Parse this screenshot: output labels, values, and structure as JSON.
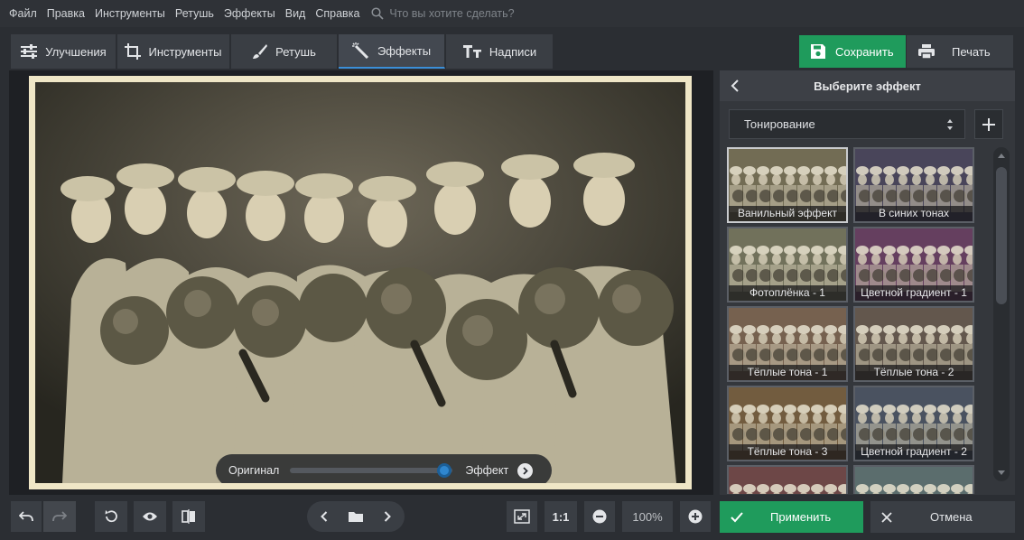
{
  "menu": {
    "items": [
      "Файл",
      "Правка",
      "Инструменты",
      "Ретушь",
      "Эффекты",
      "Вид",
      "Справка"
    ],
    "search_placeholder": "Что вы хотите сделать?"
  },
  "tabs": [
    {
      "label": "Улучшения",
      "icon": "sliders-icon"
    },
    {
      "label": "Инструменты",
      "icon": "crop-icon"
    },
    {
      "label": "Ретушь",
      "icon": "brush-icon"
    },
    {
      "label": "Эффекты",
      "icon": "magic-wand-icon",
      "active": true
    },
    {
      "label": "Надписи",
      "icon": "text-icon"
    }
  ],
  "toolbar": {
    "save_label": "Сохранить",
    "print_label": "Печать"
  },
  "compare": {
    "original_label": "Оригинал",
    "effect_label": "Эффект",
    "position": 0.95
  },
  "panel": {
    "title": "Выберите эффект",
    "category": "Тонирование",
    "effects": [
      {
        "label": "Ванильный эффект",
        "tint": "#b9ad86",
        "selected": true
      },
      {
        "label": "В синих тонах",
        "tint": "#6d6690"
      },
      {
        "label": "Фотоплёнка - 1",
        "tint": "#b7b793"
      },
      {
        "label": "Цветной градиент - 1",
        "tint": "#a05b9a"
      },
      {
        "label": "Тёплые тона - 1",
        "tint": "#c09a7c"
      },
      {
        "label": "Тёплые тона - 2",
        "tint": "#9d8778"
      },
      {
        "label": "Тёплые тона - 3",
        "tint": "#b89060"
      },
      {
        "label": "Цветной градиент - 2",
        "tint": "#6f7f9b"
      },
      {
        "label": "",
        "tint": "#b06a6e"
      },
      {
        "label": "",
        "tint": "#8fb0b2"
      }
    ]
  },
  "bottom": {
    "ratio_label": "1:1",
    "zoom_label": "100%",
    "apply_label": "Применить",
    "cancel_label": "Отмена"
  },
  "colors": {
    "accent_green": "#1f9b5c",
    "accent_blue": "#3b8fd8"
  }
}
